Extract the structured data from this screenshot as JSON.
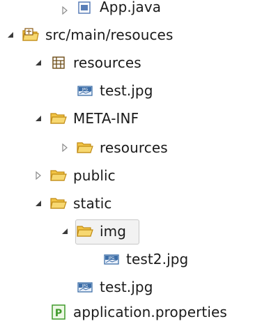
{
  "tree": {
    "items": [
      {
        "label": "App.java",
        "icon": "java-file-icon",
        "toggle": "collapsed-arrow-icon"
      },
      {
        "label": "src/main/resouces",
        "icon": "source-folder-icon",
        "toggle": "expanded-arrow-icon"
      },
      {
        "label": "resources",
        "icon": "package-icon",
        "toggle": "expanded-arrow-icon"
      },
      {
        "label": "test.jpg",
        "icon": "jpg-file-icon",
        "toggle": ""
      },
      {
        "label": "META-INF",
        "icon": "folder-icon",
        "toggle": "expanded-arrow-icon"
      },
      {
        "label": "resources",
        "icon": "folder-icon",
        "toggle": "collapsed-arrow-icon"
      },
      {
        "label": "public",
        "icon": "folder-icon",
        "toggle": "collapsed-arrow-icon"
      },
      {
        "label": "static",
        "icon": "folder-icon",
        "toggle": "expanded-arrow-icon"
      },
      {
        "label": "img",
        "icon": "folder-icon",
        "toggle": "expanded-arrow-icon"
      },
      {
        "label": "test2.jpg",
        "icon": "jpg-file-icon",
        "toggle": ""
      },
      {
        "label": "test.jpg",
        "icon": "jpg-file-icon",
        "toggle": ""
      },
      {
        "label": "application.properties",
        "icon": "properties-file-icon",
        "toggle": ""
      }
    ]
  },
  "colors": {
    "folder": "#f2c445",
    "folder_edge": "#c08a14",
    "arrow_expanded": "#3a3a3a",
    "arrow_collapsed": "#8c8c8c",
    "jpg": "#3d6ea8",
    "properties": "#3f9a2a"
  }
}
